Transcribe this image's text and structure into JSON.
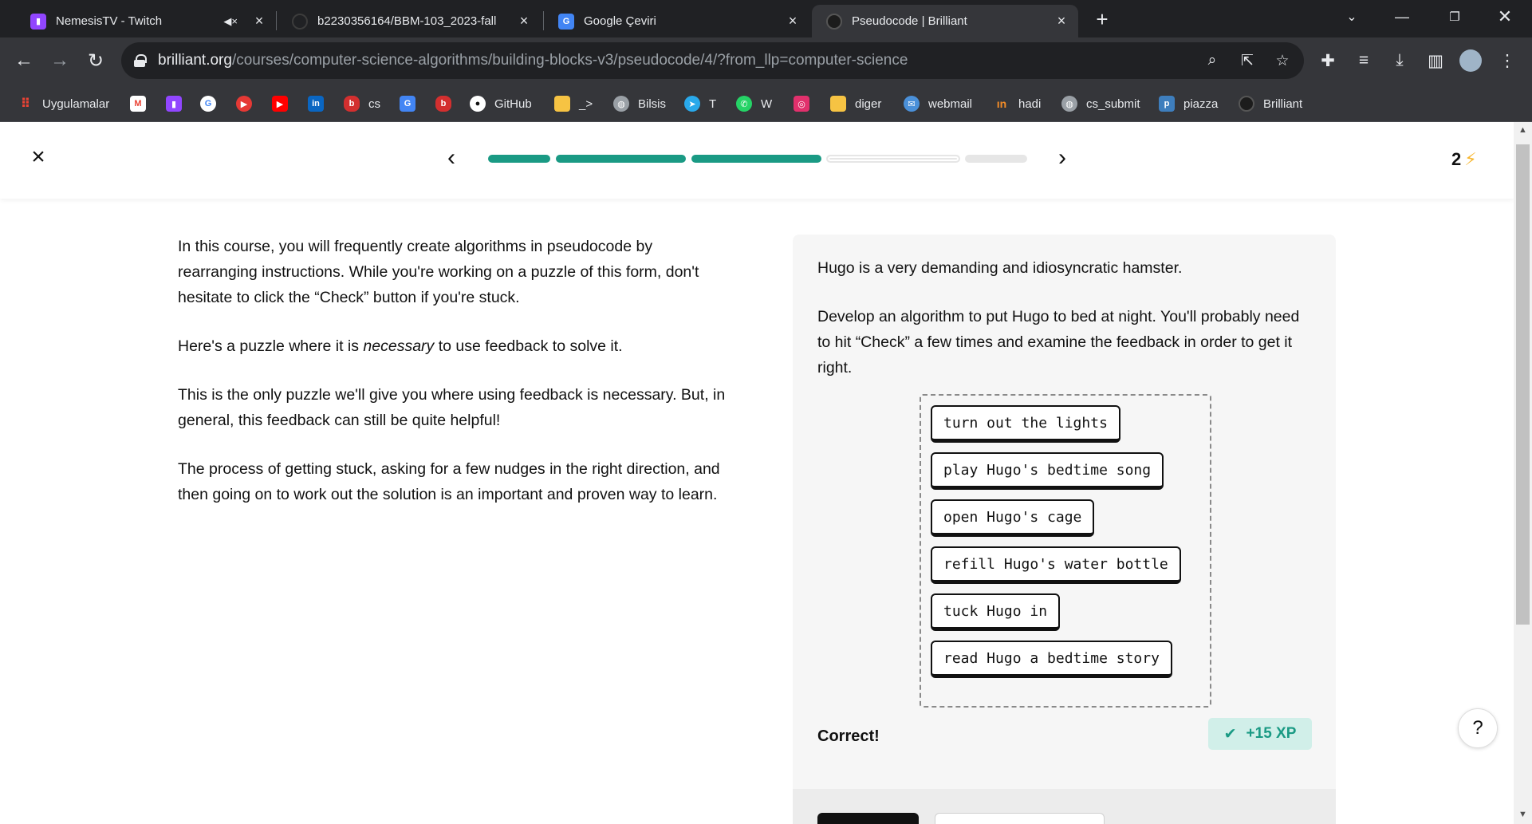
{
  "tabs": [
    {
      "title": "NemesisTV - Twitch",
      "favicon": "twitch-icon",
      "muted": true
    },
    {
      "title": "b2230356164/BBM-103_2023-fall",
      "favicon": "github-icon"
    },
    {
      "title": "Google Çeviri",
      "favicon": "google-translate-icon"
    },
    {
      "title": "Pseudocode | Brilliant",
      "favicon": "brilliant-icon",
      "active": true
    }
  ],
  "new_tab_label": "+",
  "address_bar": {
    "host": "brilliant.org",
    "path": "/courses/computer-science-algorithms/building-blocks-v3/pseudocode/4/?from_llp=computer-science"
  },
  "bookmarks": [
    {
      "label": "Uygulamalar",
      "icon": "apps-grid-icon"
    },
    {
      "label": "",
      "icon": "gmail-icon"
    },
    {
      "label": "",
      "icon": "twitch-icon"
    },
    {
      "label": "",
      "icon": "google-icon"
    },
    {
      "label": "",
      "icon": "play-icon"
    },
    {
      "label": "",
      "icon": "youtube-icon"
    },
    {
      "label": "",
      "icon": "linkedin-icon"
    },
    {
      "label": "cs",
      "icon": "bookmark-red-icon"
    },
    {
      "label": "",
      "icon": "google-translate-icon"
    },
    {
      "label": "",
      "icon": "bookmark-red-icon"
    },
    {
      "label": "GitHub",
      "icon": "github-icon"
    },
    {
      "label": "_>",
      "icon": "folder-icon"
    },
    {
      "label": "Bilsis",
      "icon": "globe-icon"
    },
    {
      "label": "T",
      "icon": "telegram-icon"
    },
    {
      "label": "W",
      "icon": "whatsapp-icon"
    },
    {
      "label": "",
      "icon": "instagram-icon"
    },
    {
      "label": "diger",
      "icon": "folder-icon"
    },
    {
      "label": "webmail",
      "icon": "webmail-icon"
    },
    {
      "label": "hadi",
      "icon": "hadi-icon"
    },
    {
      "label": "cs_submit",
      "icon": "globe-icon"
    },
    {
      "label": "piazza",
      "icon": "piazza-icon"
    },
    {
      "label": "Brilliant",
      "icon": "brilliant-icon"
    }
  ],
  "lesson": {
    "streak_count": "2",
    "progress_segments": [
      "done",
      "done",
      "done",
      "current",
      "todo"
    ],
    "intro_paragraphs": [
      "In this course, you will frequently create algorithms in pseudocode by rearranging instructions. While you're working on a puzzle of this form, don't hesitate to click the “Check” button if you're stuck.",
      "This is the only puzzle we'll give you where using feedback is necessary. But, in general, this feedback can still be quite helpful!",
      "The process of getting stuck, asking for a few nudges in the right direction, and then going on to work out the solution is an important and proven way to learn."
    ],
    "necessary_sentence": {
      "before": "Here's a puzzle where it is ",
      "emph": "necessary",
      "after": " to use feedback to solve it."
    },
    "problem_paragraphs": [
      "Hugo is a very demanding and idiosyncratic hamster.",
      "Develop an algorithm to put Hugo to bed at night. You'll probably need to hit “Check” a few times and examine the feedback in order to get it right."
    ],
    "blocks": [
      "turn out the lights",
      "play Hugo's bedtime song",
      "open Hugo's cage",
      "refill Hugo's water bottle",
      "tuck Hugo in",
      "read Hugo a bedtime story"
    ],
    "result_text": "Correct!",
    "xp_text": "+15 XP",
    "help_label": "?"
  },
  "colors": {
    "accent": "#1a9a84",
    "bolt": "#f7b733",
    "chrome_dark": "#202124",
    "chrome": "#35363a"
  }
}
